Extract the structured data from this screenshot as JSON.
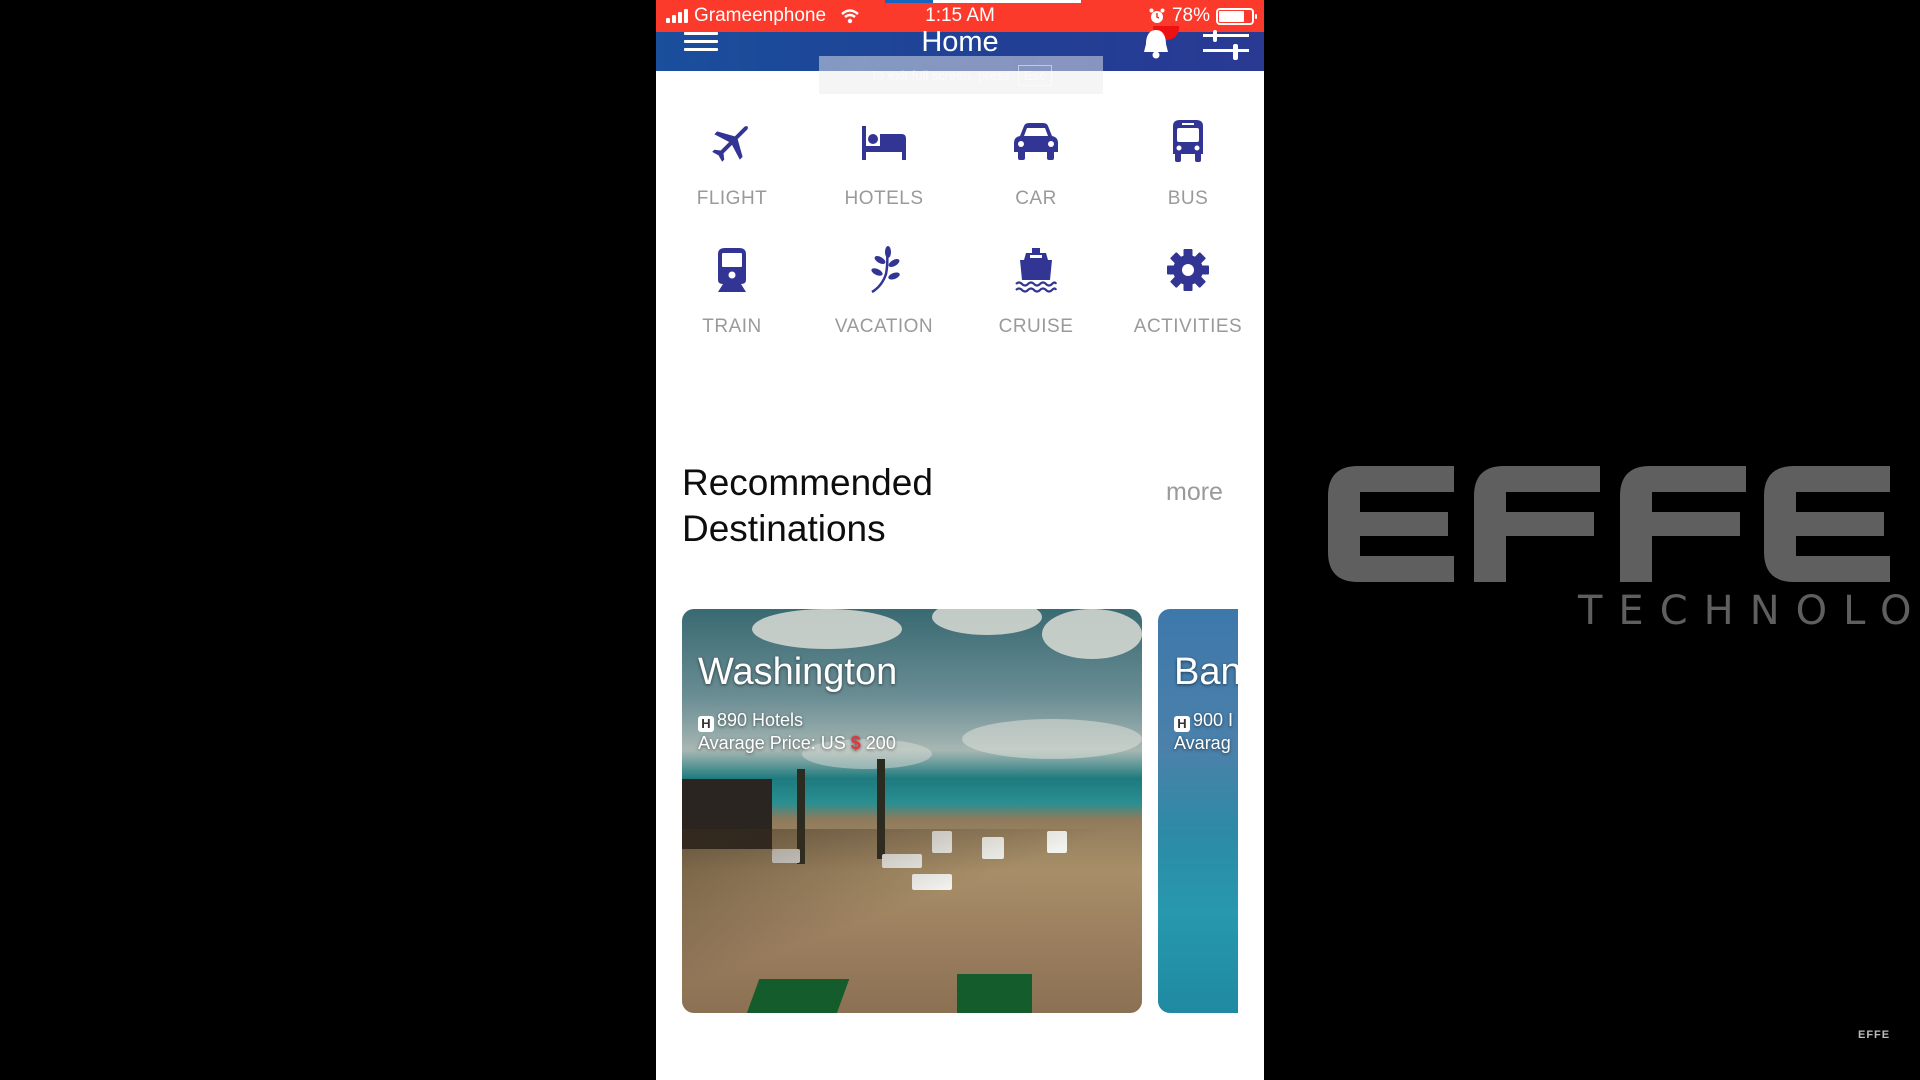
{
  "status_bar": {
    "carrier": "Grameenphone",
    "time": "1:15 AM",
    "battery_percent": "78%",
    "battery_level": 0.78,
    "bar_color": "#fb3a2c"
  },
  "nav": {
    "title": "Home",
    "menu_icon": "hamburger-icon",
    "notification_icon": "bell-icon",
    "filter_icon": "sliders-icon",
    "bar_color": "#1f4598"
  },
  "fullscreen_hint": {
    "text": "To exit full screen, press",
    "key": "Esc"
  },
  "services": [
    {
      "label": "FLIGHT",
      "icon": "airplane-icon"
    },
    {
      "label": "HOTELS",
      "icon": "bed-icon"
    },
    {
      "label": "CAR",
      "icon": "car-icon"
    },
    {
      "label": "BUS",
      "icon": "bus-icon"
    },
    {
      "label": "TRAIN",
      "icon": "train-icon"
    },
    {
      "label": "VACATION",
      "icon": "leaf-icon"
    },
    {
      "label": "CRUISE",
      "icon": "ship-icon"
    },
    {
      "label": "ACTIVITIES",
      "icon": "gear-icon"
    }
  ],
  "icon_color": "#333594",
  "recommended": {
    "title_line1": "Recommended",
    "title_line2": "Destinations",
    "more_label": "more",
    "cards": [
      {
        "city": "Washington",
        "hotels": "890 Hotels",
        "price_prefix": "Avarage Price: US",
        "currency": "$",
        "price": "200"
      },
      {
        "city": "Ban",
        "hotels": "900 I",
        "price_prefix": "Avarag"
      }
    ]
  },
  "branding": {
    "logo": "EFFE",
    "tagline": "TECHNOLOGY",
    "watermark": "EFFE"
  }
}
